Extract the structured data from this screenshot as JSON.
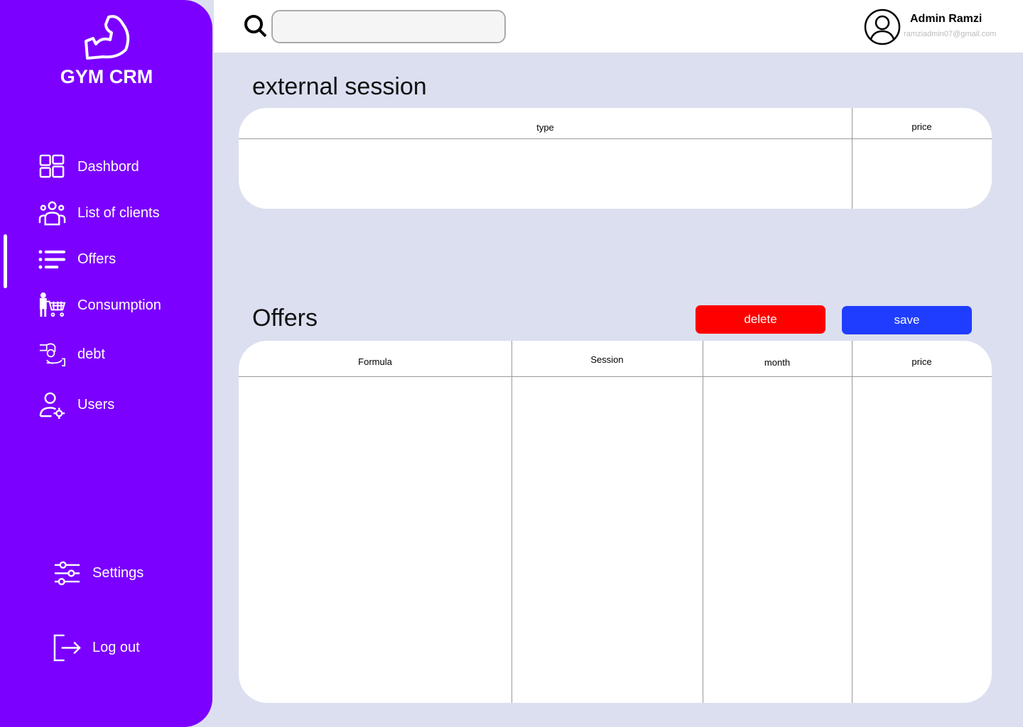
{
  "brand": "GYM CRM",
  "nav": [
    {
      "label": "Dashbord"
    },
    {
      "label": "List of clients"
    },
    {
      "label": "Offers"
    },
    {
      "label": "Consumption"
    },
    {
      "label": "debt"
    },
    {
      "label": "Users"
    }
  ],
  "settings": "Settings",
  "logout": "Log out",
  "search": {
    "placeholder": ""
  },
  "user": {
    "name": "Admin Ramzi",
    "email": "ramziadmin07@gmail.com"
  },
  "external": {
    "title": "external session",
    "columns": [
      "type",
      "price"
    ]
  },
  "offers": {
    "title": "Offers",
    "delete": "delete",
    "save": "save",
    "columns": [
      "Formula",
      "Session",
      "month",
      "price"
    ]
  },
  "colors": {
    "sidebar": "#7b00ff",
    "delete": "#ff0000",
    "save": "#1f3dff"
  }
}
